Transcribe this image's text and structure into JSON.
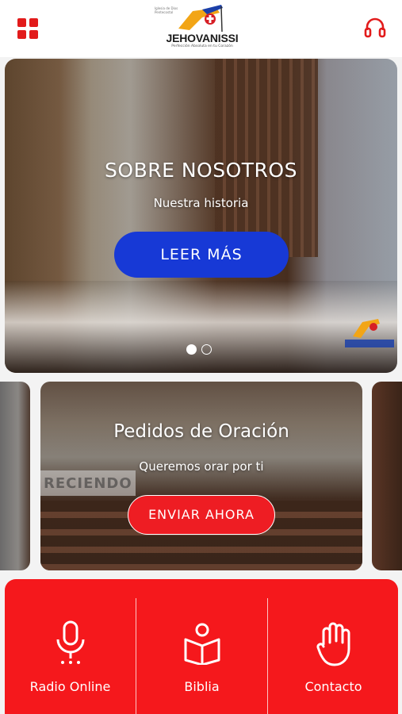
{
  "header": {
    "menu_icon": "grid-menu-icon",
    "logo_text": "JEHOVANISSI",
    "logo_tagline": "Perfección Absoluta en tu Corazón",
    "logo_top": "Iglesia de Dios Pentecostal",
    "audio_icon": "headphones-icon",
    "accent_color": "#e21b1b"
  },
  "hero": {
    "title": "SOBRE NOSOTROS",
    "subtitle": "Nuestra historia",
    "button_label": "LEER MÁS",
    "button_color": "#1739d6",
    "slide_count": 2,
    "active_slide": 1
  },
  "prayer": {
    "title": "Pedidos de Oración",
    "subtitle": "Queremos orar por ti",
    "button_label": "ENVIAR AHORA",
    "button_color": "#ee1d23",
    "banner_text": "RECIENDO"
  },
  "bottom_nav": {
    "background": "#f5181c",
    "items": [
      {
        "label": "Radio Online",
        "icon": "microphone-icon"
      },
      {
        "label": "Biblia",
        "icon": "bible-icon"
      },
      {
        "label": "Contacto",
        "icon": "hand-icon"
      }
    ]
  }
}
